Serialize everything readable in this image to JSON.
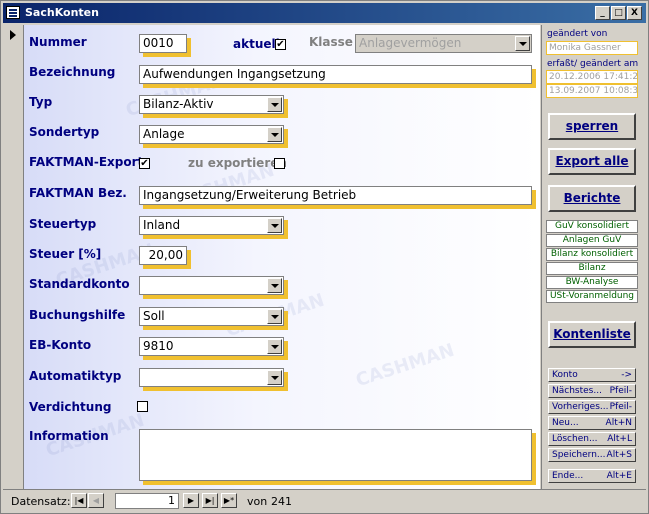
{
  "window": {
    "title": "SachKonten",
    "min_label": "_",
    "max_label": "□",
    "close_label": "X"
  },
  "form": {
    "watermark": "CASHMAN",
    "nummer": {
      "label": "Nummer",
      "value": "0010"
    },
    "aktuell": {
      "label": "aktuell",
      "checked": "✔"
    },
    "klasse": {
      "label": "Klasse",
      "value": "Anlagevermögen"
    },
    "bezeichnung": {
      "label": "Bezeichnung",
      "value": "Aufwendungen Ingangsetzung"
    },
    "typ": {
      "label": "Typ",
      "value": "Bilanz-Aktiv"
    },
    "sondertyp": {
      "label": "Sondertyp",
      "value": "Anlage"
    },
    "faktman_export": {
      "label": "FAKTMAN-Export",
      "checked": "✔"
    },
    "zu_exportieren": {
      "label": "zu exportieren",
      "checked": ""
    },
    "faktman_bez": {
      "label": "FAKTMAN Bez.",
      "value": "Ingangsetzung/Erweiterung Betrieb"
    },
    "steuertyp": {
      "label": "Steuertyp",
      "value": "Inland"
    },
    "steuer": {
      "label": "Steuer [%]",
      "value": "20,00"
    },
    "standardkonto": {
      "label": "Standardkonto",
      "value": ""
    },
    "buchungshilfe": {
      "label": "Buchungshilfe",
      "value": "Soll"
    },
    "eb_konto": {
      "label": "EB-Konto",
      "value": "9810"
    },
    "automatiktyp": {
      "label": "Automatiktyp",
      "value": ""
    },
    "verdichtung": {
      "label": "Verdichtung",
      "checked": ""
    },
    "information": {
      "label": "Information",
      "value": ""
    }
  },
  "sidebar": {
    "geaendert_von_label": "geändert von",
    "geaendert_von": "Monika Gassner",
    "erfasst_label": "erfaßt/ geändert am",
    "erfasst_am": "20.12.2006 17:41:24",
    "geaendert_am": "13.09.2007 10:08:35",
    "sperren": "sperren",
    "export_alle": "Export alle",
    "berichte": "Berichte",
    "reports": [
      "GuV konsolidiert",
      "Anlagen GuV",
      "Bilanz konsolidiert",
      "Bilanz",
      "BW-Analyse",
      "USt-Voranmeldung"
    ],
    "kontenliste": "Kontenliste",
    "nav_buttons": [
      {
        "label": "Konto",
        "key": "->"
      },
      {
        "label": "Nächstes...",
        "key": "Pfeil-"
      },
      {
        "label": "Vorheriges...",
        "key": "Pfeil-"
      },
      {
        "label": "Neu...",
        "key": "Alt+N"
      },
      {
        "label": "Löschen...",
        "key": "Alt+L"
      },
      {
        "label": "Speichern...",
        "key": "Alt+S"
      }
    ],
    "ende": {
      "label": "Ende...",
      "key": "Alt+E"
    }
  },
  "navigation": {
    "label": "Datensatz:",
    "current": "1",
    "of_label": "von",
    "total": "241",
    "first": "|◀",
    "prev": "◀",
    "next": "▶",
    "last": "▶|",
    "new": "▶*"
  }
}
